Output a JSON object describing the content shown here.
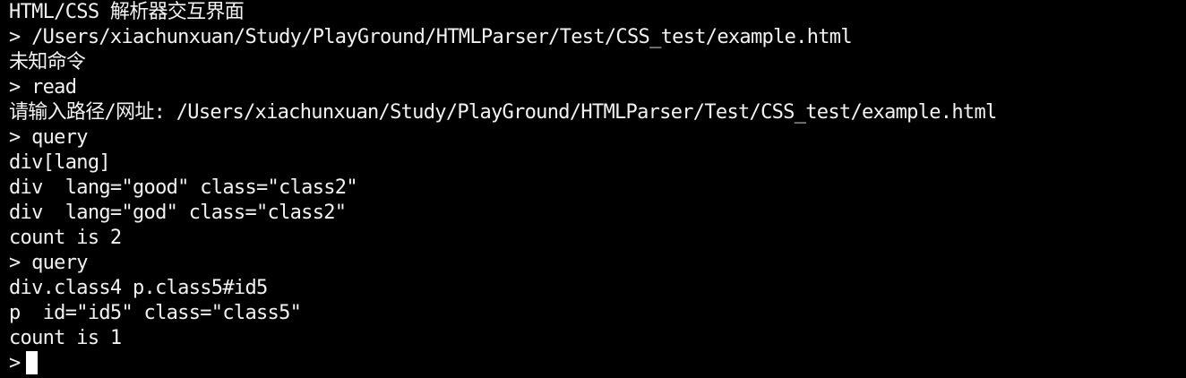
{
  "terminal": {
    "lines": [
      "HTML/CSS 解析器交互界面",
      "> /Users/xiachunxuan/Study/PlayGround/HTMLParser/Test/CSS_test/example.html",
      "未知命令",
      "> read",
      "请输入路径/网址: /Users/xiachunxuan/Study/PlayGround/HTMLParser/Test/CSS_test/example.html",
      "> query",
      "div[lang]",
      "div  lang=\"good\" class=\"class2\"",
      "div  lang=\"god\" class=\"class2\"",
      "count is 2",
      "> query",
      "div.class4 p.class5#id5",
      "p  id=\"id5\" class=\"class5\"",
      "count is 1"
    ],
    "prompt": ">"
  },
  "colors": {
    "background": "#000000",
    "text": "#f2f2f2",
    "cursor": "#ffffff"
  }
}
